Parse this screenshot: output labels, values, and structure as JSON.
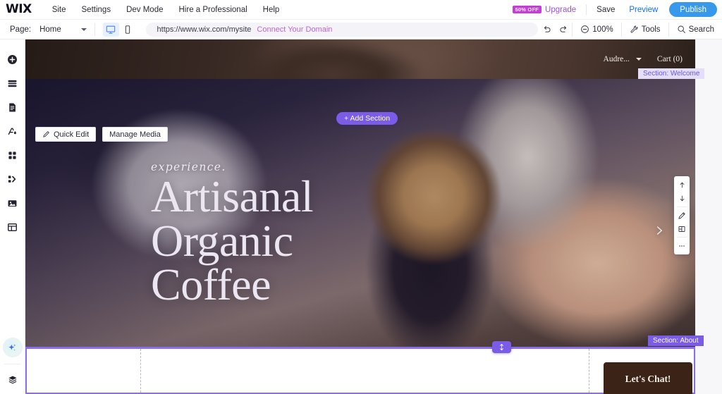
{
  "topbar": {
    "logo": "WIX",
    "menu": [
      {
        "label": "Site"
      },
      {
        "label": "Settings"
      },
      {
        "label": "Dev Mode"
      },
      {
        "label": "Hire a Professional"
      },
      {
        "label": "Help"
      }
    ],
    "promo_badge": "50% OFF",
    "upgrade_label": "Upgrade",
    "save_label": "Save",
    "preview_label": "Preview",
    "publish_label": "Publish"
  },
  "subbar": {
    "page_label": "Page:",
    "page_name": "Home",
    "url": "https://www.wix.com/mysite",
    "connect_domain": "Connect Your Domain",
    "zoom_level": "100%",
    "tools_label": "Tools",
    "search_label": "Search",
    "desktop_icon": "desktop-icon",
    "mobile_icon": "mobile-icon",
    "undo_icon": "undo-icon",
    "redo_icon": "redo-icon"
  },
  "sidebar": {
    "items": [
      {
        "name": "add-elements",
        "icon": "plus-circle-icon"
      },
      {
        "name": "add-section",
        "icon": "sections-icon"
      },
      {
        "name": "pages-menu",
        "icon": "page-icon"
      },
      {
        "name": "site-design",
        "icon": "design-theme-icon"
      },
      {
        "name": "apps-market",
        "icon": "apps-grid-icon"
      },
      {
        "name": "embed-code",
        "icon": "embed-code-icon"
      },
      {
        "name": "media-manager",
        "icon": "image-icon"
      },
      {
        "name": "content-manager",
        "icon": "database-table-icon"
      }
    ],
    "ai_item": {
      "name": "ai-assistant",
      "icon": "ai-sparkle-icon"
    },
    "layers_item": {
      "name": "layers-panel",
      "icon": "layers-icon"
    }
  },
  "canvas": {
    "site_header": {
      "account_name": "Audre...",
      "cart_label": "Cart (0)"
    },
    "add_section_label": "+ Add Section",
    "section_welcome_label": "Section: Welcome",
    "section_about_label": "Section: About",
    "hero": {
      "quick_edit_label": "Quick Edit",
      "manage_media_label": "Manage Media",
      "script_text": "experience.",
      "title_line1": "Artisanal",
      "title_line2": "Organic",
      "title_line3": "Coffee",
      "next_slide_icon": "chevron-right-icon"
    },
    "float_tools": [
      {
        "name": "move-up-button",
        "icon": "arrow-up-icon"
      },
      {
        "name": "move-down-button",
        "icon": "arrow-down-icon"
      },
      {
        "name": "edit-design-button",
        "icon": "pencil-icon"
      },
      {
        "name": "layout-button",
        "icon": "layout-icon"
      },
      {
        "name": "more-options-button",
        "icon": "ellipsis-icon"
      }
    ],
    "about": {
      "chat_button_label": "Let's Chat!"
    },
    "resize_handle_icon": "vertical-resize-icon"
  },
  "colors": {
    "accent_purple": "#7a5ce6",
    "publish_blue": "#3899ec",
    "promo_magenta": "#c63cd8",
    "upgrade_purple": "#9b51e0",
    "connect_link": "#c161e8",
    "chat_button": "#3b2318"
  }
}
